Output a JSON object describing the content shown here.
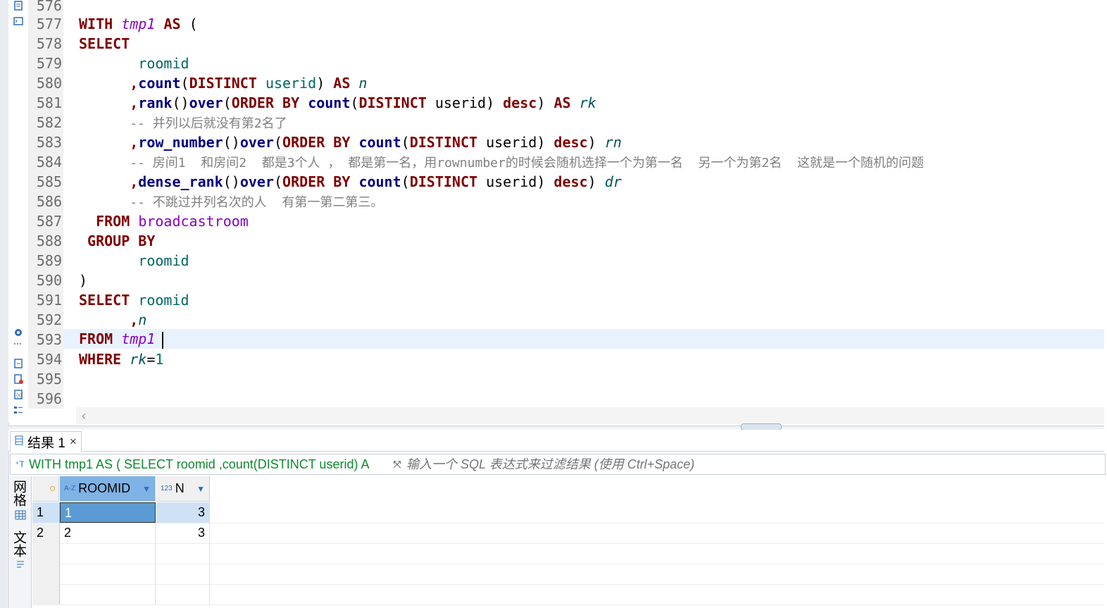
{
  "editor": {
    "line_numbers": [
      "576",
      "577",
      "578",
      "579",
      "580",
      "581",
      "582",
      "583",
      "584",
      "585",
      "586",
      "587",
      "588",
      "589",
      "590",
      "591",
      "592",
      "593",
      "594",
      "595",
      "596"
    ],
    "code": {
      "l577": {
        "kw1": "WITH",
        "tbl": "tmp1",
        "kw2": "AS",
        "rest": "("
      },
      "l578": {
        "kw": "SELECT"
      },
      "l579": {
        "id": "roomid"
      },
      "l580": {
        "comma": ",",
        "fn": "count",
        "p1": "(",
        "kw": "DISTINCT",
        "id": "userid",
        "p2": ")",
        "kw2": "AS",
        "alias": "n"
      },
      "l581": {
        "comma": ",",
        "fn1": "rank",
        "p1": "()",
        "fn2": "over",
        "p2": "(",
        "kw1": "ORDER",
        "kw2": "BY",
        "fn3": "count",
        "p3": "(",
        "kw3": "DISTINCT",
        "id": "userid",
        "p4": ")",
        "kw4": "desc",
        "p5": ")",
        "kw5": "AS",
        "alias": "rk"
      },
      "l582": {
        "comment": "-- 并列以后就没有第2名了"
      },
      "l583": {
        "comma": ",",
        "fn1": "row_number",
        "p1": "()",
        "fn2": "over",
        "p2": "(",
        "kw1": "ORDER",
        "kw2": "BY",
        "fn3": "count",
        "p3": "(",
        "kw3": "DISTINCT",
        "id": "userid",
        "p4": ")",
        "kw4": "desc",
        "p5": ")",
        "alias": "rn"
      },
      "l584": {
        "comment": "-- 房间1  和房间2  都是3个人 ， 都是第一名，用rownumber的时候会随机选择一个为第一名  另一个为第2名  这就是一个随机的问题"
      },
      "l585": {
        "comma": ",",
        "fn1": "dense_rank",
        "p1": "()",
        "fn2": "over",
        "p2": "(",
        "kw1": "ORDER",
        "kw2": "BY",
        "fn3": "count",
        "p3": "(",
        "kw3": "DISTINCT",
        "id": "userid",
        "p4": ")",
        "kw4": "desc",
        "p5": ")",
        "alias": "dr"
      },
      "l586": {
        "comment": "-- 不跳过并列名次的人  有第一第二第三。"
      },
      "l587": {
        "kw": "FROM",
        "tbl": "broadcastroom"
      },
      "l588": {
        "kw": "GROUP BY"
      },
      "l589": {
        "id": "roomid"
      },
      "l590": {
        "p": ")"
      },
      "l591": {
        "kw": "SELECT",
        "id": "roomid"
      },
      "l592": {
        "comma": ",",
        "alias": "n"
      },
      "l593": {
        "kw": "FROM",
        "tbl": "tmp1"
      },
      "l594": {
        "kw": "WHERE",
        "alias": "rk",
        "op": "=",
        "num": "1"
      }
    }
  },
  "results": {
    "tab_label": "结果 1",
    "tab_close": "×",
    "query_text": "WITH tmp1 AS ( SELECT roomid ,count(DISTINCT userid) A",
    "filter_placeholder": "输入一个 SQL 表达式来过滤结果 (使用 Ctrl+Space)",
    "side_tabs": {
      "grid": "网格",
      "text": "文本"
    },
    "columns": [
      {
        "name": "ROOMID",
        "type_icon": "A-Z"
      },
      {
        "name": "N",
        "type_icon": "123"
      }
    ],
    "rows": [
      {
        "rownum": "1",
        "roomid": "1",
        "n": "3"
      },
      {
        "rownum": "2",
        "roomid": "2",
        "n": "3"
      }
    ]
  },
  "colors": {
    "keyword": "#7f0000",
    "function": "#000080",
    "identifier": "#006666",
    "table": "#8a00c2",
    "comment": "#808080",
    "selected_cell": "#5b9bd5",
    "current_line": "#e8f2fe"
  }
}
